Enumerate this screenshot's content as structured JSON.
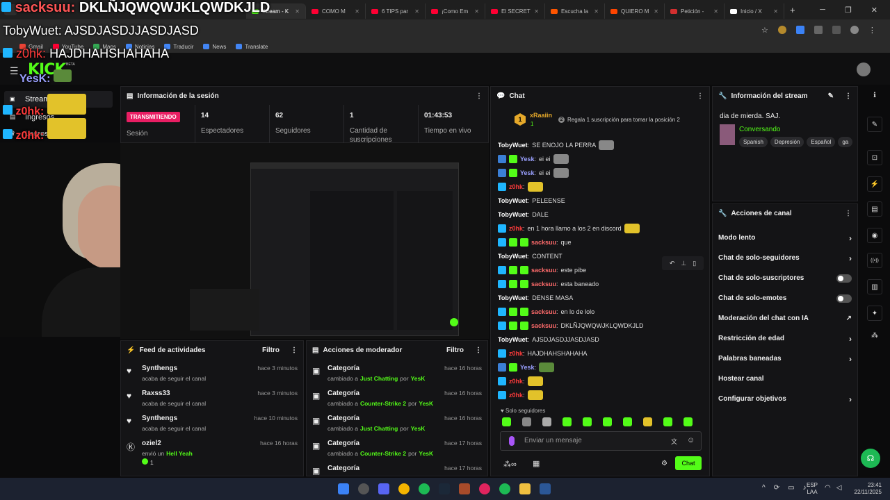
{
  "browser": {
    "tabs": [
      {
        "label": "Stream - K",
        "color": "#53fc18",
        "active": true
      },
      {
        "label": "COMO M",
        "color": "#ff0033"
      },
      {
        "label": "6 TIPS par",
        "color": "#ff0033"
      },
      {
        "label": "¡Como Em",
        "color": "#ff0033"
      },
      {
        "label": "El SECRET",
        "color": "#ff0033"
      },
      {
        "label": "Escucha la",
        "color": "#ff5500"
      },
      {
        "label": "QUIERO M",
        "color": "#ff4500"
      },
      {
        "label": "Petición -",
        "color": "#d32f2f"
      },
      {
        "label": "Inicio / X",
        "color": "#ffffff"
      }
    ],
    "new_tab": "+",
    "bookmarks": [
      {
        "label": "Gmail",
        "color": "#ea4335"
      },
      {
        "label": "YouTube",
        "color": "#ff0033"
      },
      {
        "label": "Maps",
        "color": "#34a853"
      },
      {
        "label": "Noticias",
        "color": "#4285f4"
      },
      {
        "label": "Traducir",
        "color": "#4285f4"
      },
      {
        "label": "News",
        "color": "#4285f4"
      },
      {
        "label": "Translate",
        "color": "#4285f4"
      }
    ]
  },
  "overlay": {
    "line1_user": "sacksuu:",
    "line1_msg": "DKLÑJQWQWJKLQWDKJLD",
    "line2_user": "TobyWuet:",
    "line2_msg": "AJSDJASDJJASDJASD",
    "line3_user": "z0hk:",
    "line3_msg": "HAJDHAHSHAHAHA",
    "line4_user": "YesK:",
    "line5_user": "z0hk:",
    "line6_user": "z0hk:"
  },
  "kick": {
    "logo": "KICK",
    "logo_beta": "BETA",
    "nav": [
      "Stream",
      "Ingresos",
      "Logros"
    ]
  },
  "session": {
    "title": "Información de la sesión",
    "live_badge": "TRANSMITIENDO",
    "session_label": "Sesión",
    "stats": [
      {
        "value": "14",
        "label": "Espectadores"
      },
      {
        "value": "62",
        "label": "Seguidores"
      },
      {
        "value": "1",
        "label": "Cantidad de suscripciones"
      },
      {
        "value": "01:43:53",
        "label": "Tiempo en vivo"
      }
    ]
  },
  "chat": {
    "title": "Chat",
    "top_user": "xRaaiin",
    "top_count": "1",
    "top_rank": "1",
    "top_rank_num": "2",
    "top_prompt": "Regala 1 suscripción para tomar la posición 2",
    "messages": [
      {
        "user": "TobyWuet",
        "color": "#ffffff",
        "text": "SE ENOJO LA PERRA",
        "badges": [],
        "emote": true
      },
      {
        "user": "Yesk",
        "color": "#9aa0ff",
        "text": "ei ei",
        "badges": [
          "#3b7fd6",
          "#53fc18"
        ],
        "emote": true
      },
      {
        "user": "Yesk",
        "color": "#9aa0ff",
        "text": "ei ei",
        "badges": [
          "#3b7fd6",
          "#53fc18"
        ],
        "emote": true
      },
      {
        "user": "z0hk",
        "color": "#ff3b3b",
        "text": "",
        "badges": [
          "#1fb6ff"
        ],
        "emote": true
      },
      {
        "user": "TobyWuet",
        "color": "#ffffff",
        "text": "PELEENSE",
        "badges": []
      },
      {
        "user": "TobyWuet",
        "color": "#ffffff",
        "text": "DALE",
        "badges": []
      },
      {
        "user": "z0hk",
        "color": "#ff3b3b",
        "text": "en 1 hora llamo a los 2 en discord",
        "badges": [
          "#1fb6ff"
        ],
        "emote": true
      },
      {
        "user": "sacksuu",
        "color": "#ff6b6b",
        "text": "que",
        "badges": [
          "#1fb6ff",
          "#53fc18",
          "#53fc18"
        ]
      },
      {
        "user": "TobyWuet",
        "color": "#ffffff",
        "text": "CONTENT",
        "badges": []
      },
      {
        "user": "sacksuu",
        "color": "#ff6b6b",
        "text": "este pibe",
        "badges": [
          "#1fb6ff",
          "#53fc18",
          "#53fc18"
        ]
      },
      {
        "user": "sacksuu",
        "color": "#ff6b6b",
        "text": "esta baneado",
        "badges": [
          "#1fb6ff",
          "#53fc18",
          "#53fc18"
        ]
      },
      {
        "user": "TobyWuet",
        "color": "#ffffff",
        "text": "DENSE MASA",
        "badges": []
      },
      {
        "user": "sacksuu",
        "color": "#ff6b6b",
        "text": "en lo de lolo",
        "badges": [
          "#1fb6ff",
          "#53fc18",
          "#53fc18"
        ]
      },
      {
        "user": "sacksuu",
        "color": "#ff6b6b",
        "text": "DKLÑJQWQWJKLQWDKJLD",
        "badges": [
          "#1fb6ff",
          "#53fc18",
          "#53fc18"
        ]
      },
      {
        "user": "TobyWuet",
        "color": "#ffffff",
        "text": "AJSDJASDJJASDJASD",
        "badges": []
      },
      {
        "user": "z0hk",
        "color": "#ff3b3b",
        "text": "HAJDHAHSHAHAHA",
        "badges": [
          "#1fb6ff"
        ]
      },
      {
        "user": "Yesk",
        "color": "#9aa0ff",
        "text": "",
        "badges": [
          "#3b7fd6",
          "#53fc18"
        ],
        "emote": true
      },
      {
        "user": "z0hk",
        "color": "#ff3b3b",
        "text": "",
        "badges": [
          "#1fb6ff"
        ],
        "emote": true
      },
      {
        "user": "z0hk",
        "color": "#ff3b3b",
        "text": "",
        "badges": [
          "#1fb6ff"
        ],
        "emote": true
      }
    ],
    "followers_only": "Solo seguidores",
    "input_placeholder": "Enviar un mensaje",
    "send_label": "Chat"
  },
  "stream_info": {
    "title": "Información del stream",
    "stream_title": "dia de mierda. SAJ.",
    "category": "Conversando",
    "tags": [
      "Spanish",
      "Depresión",
      "Español",
      "ga"
    ]
  },
  "channel_actions": {
    "title": "Acciones de canal",
    "items": [
      {
        "label": "Modo lento",
        "control": "chevron"
      },
      {
        "label": "Chat de solo-seguidores",
        "control": "chevron"
      },
      {
        "label": "Chat de solo-suscriptores",
        "control": "toggle"
      },
      {
        "label": "Chat de solo-emotes",
        "control": "toggle"
      },
      {
        "label": "Moderación del chat con IA",
        "control": "external"
      },
      {
        "label": "Restricción de edad",
        "control": "chevron"
      },
      {
        "label": "Palabras baneadas",
        "control": "chevron"
      },
      {
        "label": "Hostear canal",
        "control": "none"
      },
      {
        "label": "Configurar objetivos",
        "control": "chevron"
      }
    ]
  },
  "activity": {
    "title": "Feed de actividades",
    "filter": "Filtro",
    "items": [
      {
        "name": "Synthengs",
        "sub": "acaba de seguir el canal",
        "time": "hace 3 minutos",
        "icon": "heart"
      },
      {
        "name": "Raxss33",
        "sub": "acaba de seguir el canal",
        "time": "hace 3 minutos",
        "icon": "heart"
      },
      {
        "name": "Synthengs",
        "sub": "acaba de seguir el canal",
        "time": "hace 10 minutos",
        "icon": "heart"
      },
      {
        "name": "oziel2",
        "sub_prefix": "envió un",
        "sub_highlight": "Hell Yeah",
        "amount": "1",
        "time": "hace 16 horas",
        "icon": "kick"
      }
    ]
  },
  "mod_actions": {
    "title": "Acciones de moderador",
    "filter": "Filtro",
    "items": [
      {
        "name": "Categoría",
        "prefix": "cambiado a",
        "cat": "Just Chatting",
        "by": "por",
        "mod": "YesK",
        "time": "hace 16 horas"
      },
      {
        "name": "Categoría",
        "prefix": "cambiado a",
        "cat": "Counter-Strike 2",
        "by": "por",
        "mod": "YesK",
        "time": "hace 16 horas"
      },
      {
        "name": "Categoría",
        "prefix": "cambiado a",
        "cat": "Just Chatting",
        "by": "por",
        "mod": "YesK",
        "time": "hace 16 horas"
      },
      {
        "name": "Categoría",
        "prefix": "cambiado a",
        "cat": "Counter-Strike 2",
        "by": "por",
        "mod": "YesK",
        "time": "hace 17 horas"
      },
      {
        "name": "Categoría",
        "prefix": "",
        "cat": "",
        "by": "",
        "mod": "",
        "time": "hace 17 horas"
      }
    ]
  },
  "taskbar": {
    "lang1": "ESP",
    "lang2": "LAA",
    "time": "23:41",
    "date": "22/11/2025"
  },
  "colors": {
    "kick_green": "#53fc18",
    "live_red": "#e91e63"
  }
}
